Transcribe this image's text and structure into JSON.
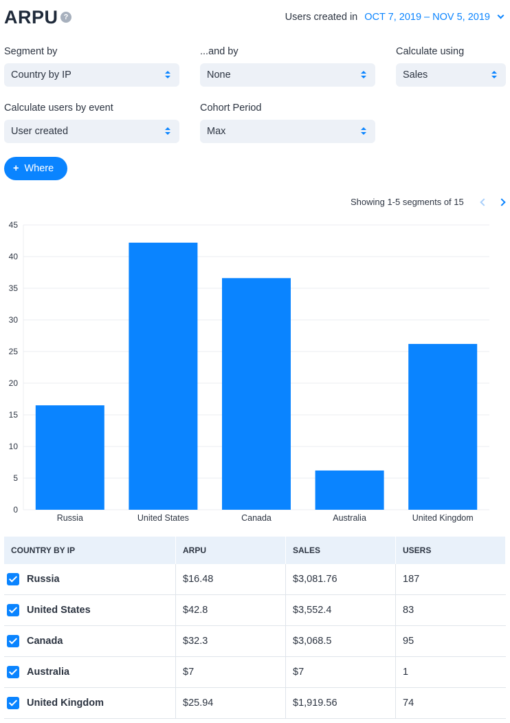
{
  "header": {
    "title": "ARPU",
    "help_glyph": "?",
    "date_label": "Users created in",
    "date_range": "OCT 7, 2019 – NOV 5, 2019"
  },
  "controls": {
    "segment_by_label": "Segment by",
    "segment_by_value": "Country by IP",
    "and_by_label": "...and by",
    "and_by_value": "None",
    "calculate_using_label": "Calculate using",
    "calculate_using_value": "Sales",
    "users_by_event_label": "Calculate users by event",
    "users_by_event_value": "User created",
    "cohort_period_label": "Cohort Period",
    "cohort_period_value": "Max",
    "where_label": "Where"
  },
  "pager": {
    "text": "Showing 1-5 segments of 15"
  },
  "colors": {
    "accent": "#0a84ff",
    "grid": "#ebeef2"
  },
  "chart_data": {
    "type": "bar",
    "categories": [
      "Russia",
      "United States",
      "Canada",
      "Australia",
      "United Kingdom"
    ],
    "values": [
      16.5,
      42.2,
      36.6,
      6.2,
      26.2
    ],
    "yticks": [
      0,
      5,
      10,
      15,
      20,
      25,
      30,
      35,
      40,
      45
    ],
    "ylim": [
      0,
      45
    ],
    "grid": true
  },
  "table": {
    "headers": [
      "COUNTRY BY IP",
      "ARPU",
      "SALES",
      "USERS"
    ],
    "rows": [
      {
        "name": "Russia",
        "arpu": "$16.48",
        "sales": "$3,081.76",
        "users": "187"
      },
      {
        "name": "United States",
        "arpu": "$42.8",
        "sales": "$3,552.4",
        "users": "83"
      },
      {
        "name": "Canada",
        "arpu": "$32.3",
        "sales": "$3,068.5",
        "users": "95"
      },
      {
        "name": "Australia",
        "arpu": "$7",
        "sales": "$7",
        "users": "1"
      },
      {
        "name": "United Kingdom",
        "arpu": "$25.94",
        "sales": "$1,919.56",
        "users": "74"
      }
    ]
  }
}
